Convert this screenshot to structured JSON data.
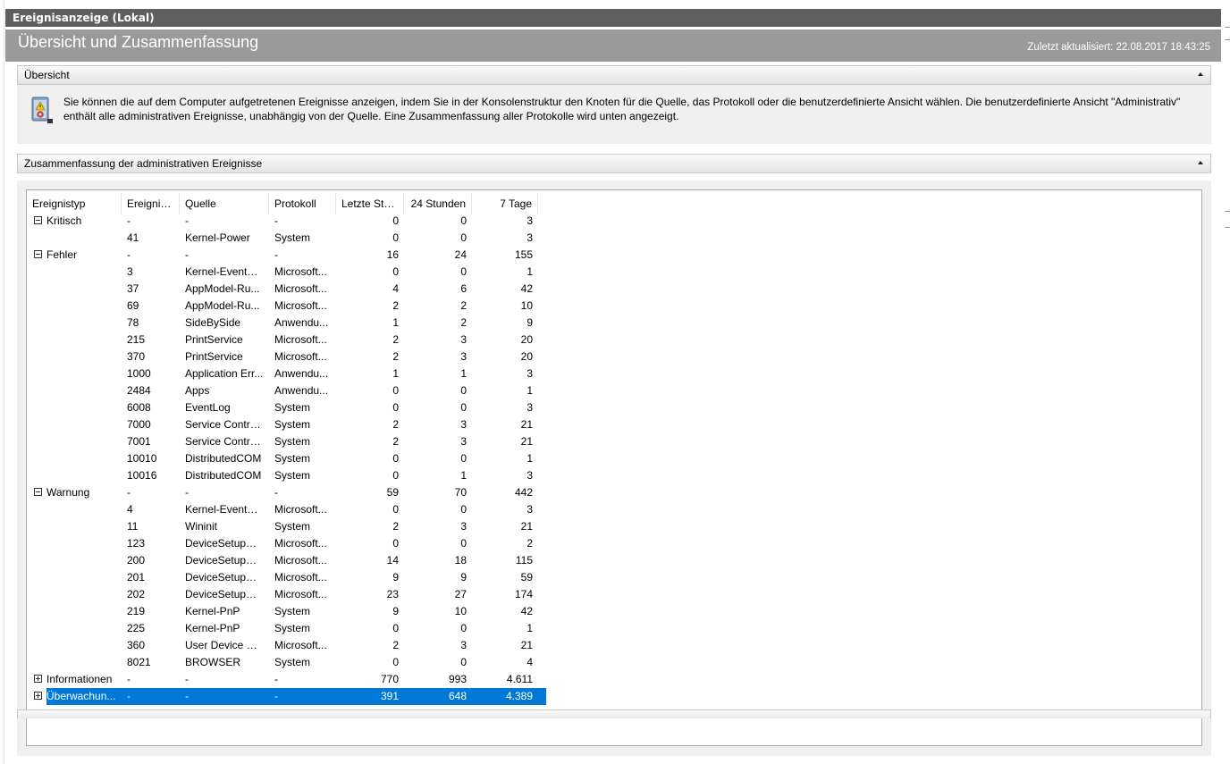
{
  "console_title": "Ereignisanzeige (Lokal)",
  "page": {
    "title": "Übersicht und Zusammenfassung",
    "updated": "Zuletzt aktualisiert: 22.08.2017 18:43:25"
  },
  "overview": {
    "header": "Übersicht",
    "icon": "event-log-icon",
    "text": "Sie können die auf dem Computer aufgetretenen Ereignisse anzeigen, indem Sie in der Konsolenstruktur den Knoten für die Quelle, das Protokoll oder die benutzerdefinierte Ansicht wählen. Die benutzerdefinierte Ansicht \"Administrativ\" enthält alle administrativen Ereignisse, unabhängig von der Quelle. Eine Zusammenfassung aller Protokolle wird unten angezeigt."
  },
  "summary": {
    "header": "Zusammenfassung der administrativen Ereignisse",
    "columns": [
      "Ereignistyp",
      "Ereignis...",
      "Quelle",
      "Protokoll",
      "Letzte Stu...",
      "24 Stunden",
      "7 Tage"
    ],
    "rows": [
      {
        "type": "Kritisch",
        "expander": "minus",
        "id": "-",
        "source": "-",
        "log": "-",
        "hour": "0",
        "day": "0",
        "week": "3"
      },
      {
        "type": "",
        "id": "41",
        "source": "Kernel-Power",
        "log": "System",
        "hour": "0",
        "day": "0",
        "week": "3"
      },
      {
        "type": "Fehler",
        "expander": "minus",
        "id": "-",
        "source": "-",
        "log": "-",
        "hour": "16",
        "day": "24",
        "week": "155"
      },
      {
        "type": "",
        "id": "3",
        "source": "Kernel-EventTr...",
        "log": "Microsoft...",
        "hour": "0",
        "day": "0",
        "week": "1"
      },
      {
        "type": "",
        "id": "37",
        "source": "AppModel-Ru...",
        "log": "Microsoft...",
        "hour": "4",
        "day": "6",
        "week": "42"
      },
      {
        "type": "",
        "id": "69",
        "source": "AppModel-Ru...",
        "log": "Microsoft...",
        "hour": "2",
        "day": "2",
        "week": "10"
      },
      {
        "type": "",
        "id": "78",
        "source": "SideBySide",
        "log": "Anwendu...",
        "hour": "1",
        "day": "2",
        "week": "9"
      },
      {
        "type": "",
        "id": "215",
        "source": "PrintService",
        "log": "Microsoft...",
        "hour": "2",
        "day": "3",
        "week": "20"
      },
      {
        "type": "",
        "id": "370",
        "source": "PrintService",
        "log": "Microsoft...",
        "hour": "2",
        "day": "3",
        "week": "20"
      },
      {
        "type": "",
        "id": "1000",
        "source": "Application Err...",
        "log": "Anwendu...",
        "hour": "1",
        "day": "1",
        "week": "3"
      },
      {
        "type": "",
        "id": "2484",
        "source": "Apps",
        "log": "Anwendu...",
        "hour": "0",
        "day": "0",
        "week": "1"
      },
      {
        "type": "",
        "id": "6008",
        "source": "EventLog",
        "log": "System",
        "hour": "0",
        "day": "0",
        "week": "3"
      },
      {
        "type": "",
        "id": "7000",
        "source": "Service Contro...",
        "log": "System",
        "hour": "2",
        "day": "3",
        "week": "21"
      },
      {
        "type": "",
        "id": "7001",
        "source": "Service Contro...",
        "log": "System",
        "hour": "2",
        "day": "3",
        "week": "21"
      },
      {
        "type": "",
        "id": "10010",
        "source": "DistributedCOM",
        "log": "System",
        "hour": "0",
        "day": "0",
        "week": "1"
      },
      {
        "type": "",
        "id": "10016",
        "source": "DistributedCOM",
        "log": "System",
        "hour": "0",
        "day": "1",
        "week": "3"
      },
      {
        "type": "Warnung",
        "expander": "minus",
        "id": "-",
        "source": "-",
        "log": "-",
        "hour": "59",
        "day": "70",
        "week": "442"
      },
      {
        "type": "",
        "id": "4",
        "source": "Kernel-EventTr...",
        "log": "Microsoft...",
        "hour": "0",
        "day": "0",
        "week": "3"
      },
      {
        "type": "",
        "id": "11",
        "source": "Wininit",
        "log": "System",
        "hour": "2",
        "day": "3",
        "week": "21"
      },
      {
        "type": "",
        "id": "123",
        "source": "DeviceSetupM...",
        "log": "Microsoft...",
        "hour": "0",
        "day": "0",
        "week": "2"
      },
      {
        "type": "",
        "id": "200",
        "source": "DeviceSetupM...",
        "log": "Microsoft...",
        "hour": "14",
        "day": "18",
        "week": "115"
      },
      {
        "type": "",
        "id": "201",
        "source": "DeviceSetupM...",
        "log": "Microsoft...",
        "hour": "9",
        "day": "9",
        "week": "59"
      },
      {
        "type": "",
        "id": "202",
        "source": "DeviceSetupM...",
        "log": "Microsoft...",
        "hour": "23",
        "day": "27",
        "week": "174"
      },
      {
        "type": "",
        "id": "219",
        "source": "Kernel-PnP",
        "log": "System",
        "hour": "9",
        "day": "10",
        "week": "42"
      },
      {
        "type": "",
        "id": "225",
        "source": "Kernel-PnP",
        "log": "System",
        "hour": "0",
        "day": "0",
        "week": "1"
      },
      {
        "type": "",
        "id": "360",
        "source": "User Device Re...",
        "log": "Microsoft...",
        "hour": "2",
        "day": "3",
        "week": "21"
      },
      {
        "type": "",
        "id": "8021",
        "source": "BROWSER",
        "log": "System",
        "hour": "0",
        "day": "0",
        "week": "4"
      },
      {
        "type": "Informationen",
        "expander": "plus",
        "id": "-",
        "source": "-",
        "log": "-",
        "hour": "770",
        "day": "993",
        "week": "4.611"
      },
      {
        "type": "Überwachun...",
        "expander": "plus",
        "selected": true,
        "id": "-",
        "source": "-",
        "log": "-",
        "hour": "391",
        "day": "648",
        "week": "4.389"
      }
    ]
  },
  "colors": {
    "console_header": "#5f5f5f",
    "page_header": "#9a9a9a",
    "selection": "#0078d7",
    "panel_bg": "#f0f0f0"
  }
}
